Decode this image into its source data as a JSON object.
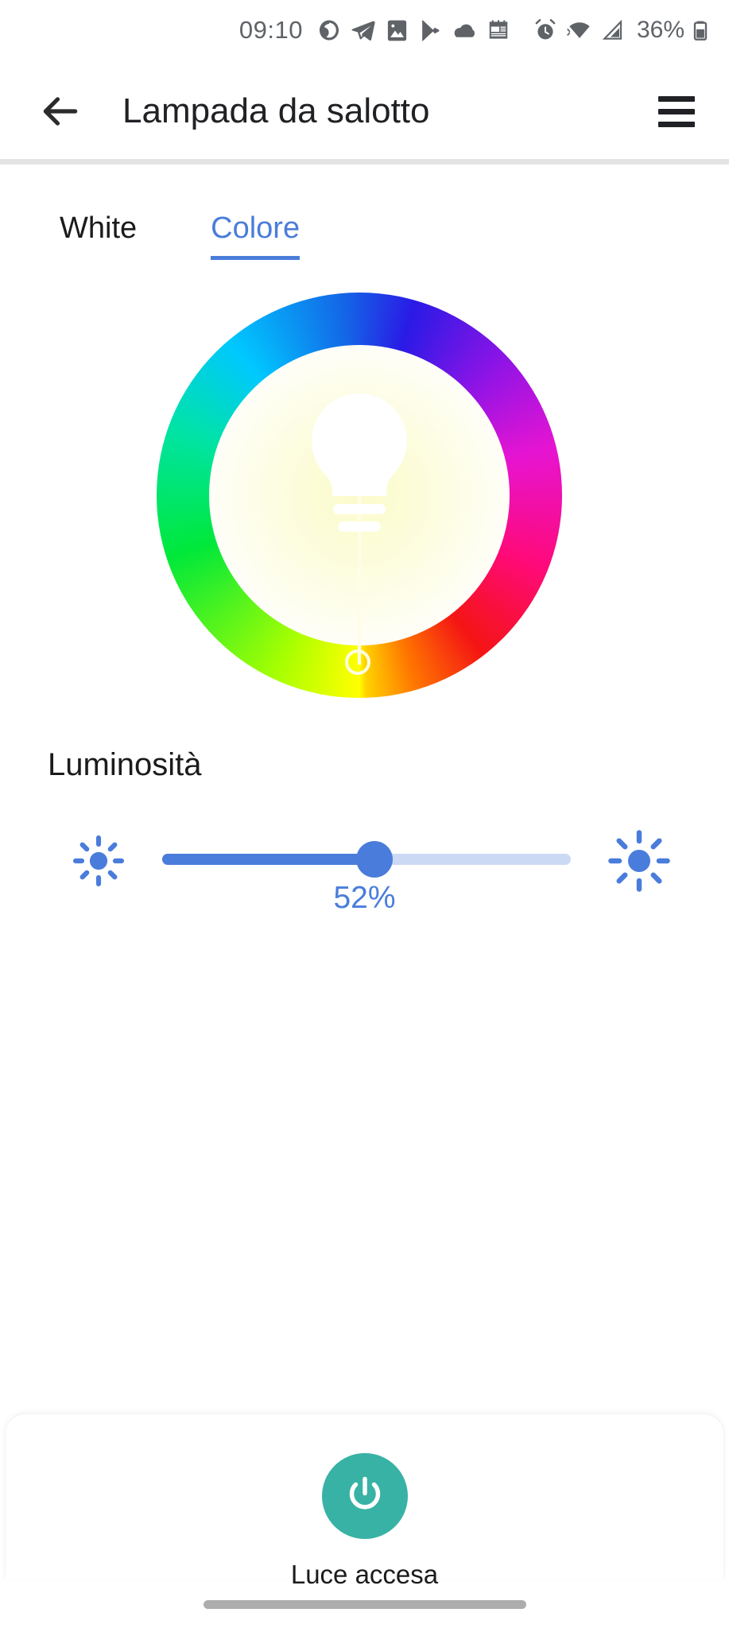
{
  "statusbar": {
    "time": "09:10",
    "battery_text": "36%",
    "icons": [
      {
        "name": "loop-ring-icon",
        "label": "loop"
      },
      {
        "name": "telegram-icon",
        "label": "telegram"
      },
      {
        "name": "gallery-image-icon",
        "label": "gallery"
      },
      {
        "name": "play-store-icon",
        "label": "play store"
      },
      {
        "name": "cloud-icon",
        "label": "cloud"
      },
      {
        "name": "news-calendar-icon",
        "label": "news"
      },
      {
        "name": "alarm-clock-icon",
        "label": "alarm"
      },
      {
        "name": "wifi-icon",
        "label": "wifi"
      },
      {
        "name": "cellular-signal-icon",
        "label": "signal"
      },
      {
        "name": "battery-icon",
        "label": "battery"
      }
    ]
  },
  "appbar": {
    "title": "Lampada da salotto",
    "back_label": "Indietro",
    "menu_label": "Menu"
  },
  "tabs": [
    {
      "label": "White",
      "active": false
    },
    {
      "label": "Colore",
      "active": true
    }
  ],
  "colorwheel": {
    "label": "Selettore colore",
    "handle_position": "bottom",
    "handle_hue_deg": 180,
    "selected_color": "#e8ff00",
    "bulb_icon": "light-bulb-icon"
  },
  "brightness": {
    "label": "Luminosità",
    "value": 52,
    "value_text": "52%",
    "min_icon": "brightness-low-icon",
    "max_icon": "brightness-high-icon",
    "accent_color": "#4a7ddb",
    "track_color": "#ccd9f5"
  },
  "power": {
    "label": "Luce accesa",
    "state": "on",
    "color": "#38b2a4",
    "icon": "power-icon"
  },
  "navbar": {
    "gesture_bar_label": "Barra di navigazione"
  }
}
